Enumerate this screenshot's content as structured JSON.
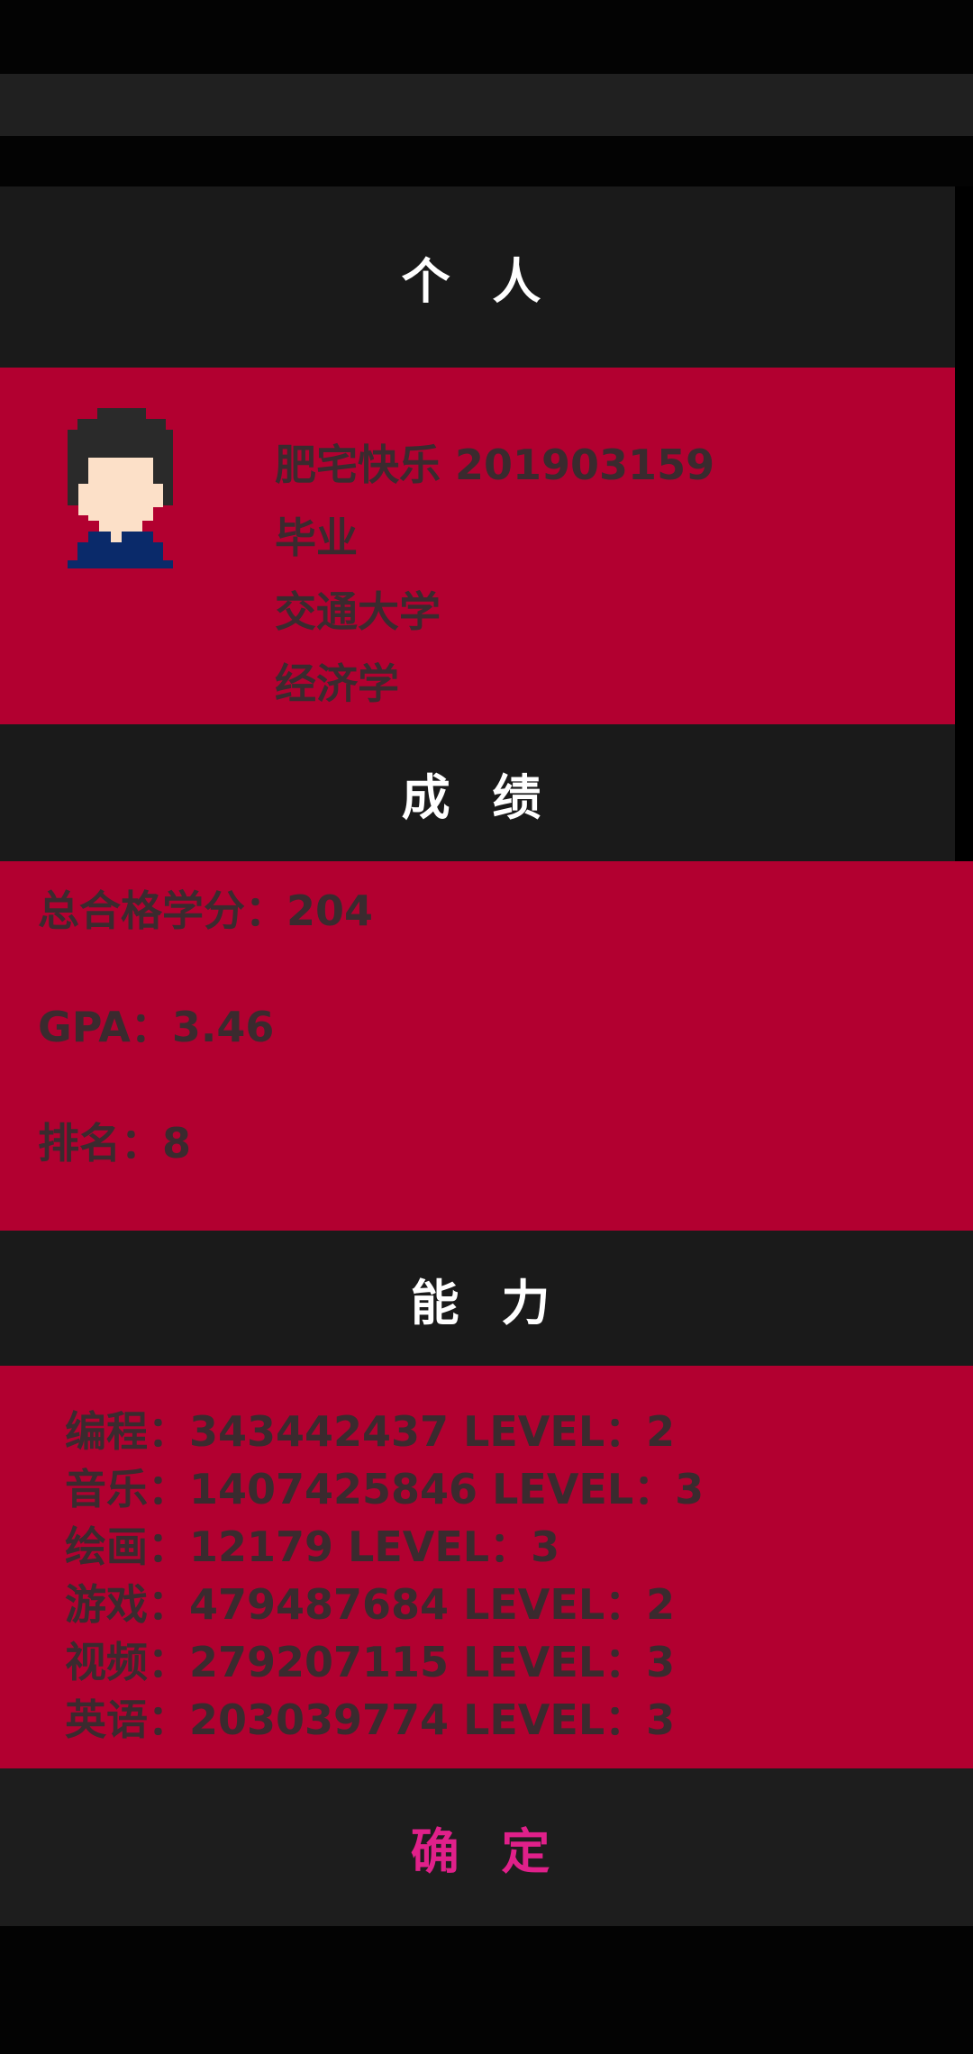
{
  "headers": {
    "personal": "个 人",
    "grades": "成 绩",
    "abilities": "能 力"
  },
  "profile": {
    "name_id": "肥宅快乐  201903159",
    "status": "毕业",
    "school": "交通大学",
    "major": "经济学"
  },
  "grades": {
    "credits": "总合格学分：204",
    "gpa": "GPA：3.46",
    "rank": "排名：8"
  },
  "abilities": [
    "编程：343442437    LEVEL：2",
    "音乐：1407425846    LEVEL：3",
    "绘画：12179    LEVEL：3",
    "游戏：479487684    LEVEL：2",
    "视频：279207115    LEVEL：3",
    "英语：203039774    LEVEL：3"
  ],
  "confirm_label": "确 定",
  "colors": {
    "accent_red": "#b20030",
    "panel_dark": "#1a1a1a",
    "confirm_pink": "#e0208a"
  },
  "icons": {
    "avatar": "pixel-student-avatar-icon"
  }
}
